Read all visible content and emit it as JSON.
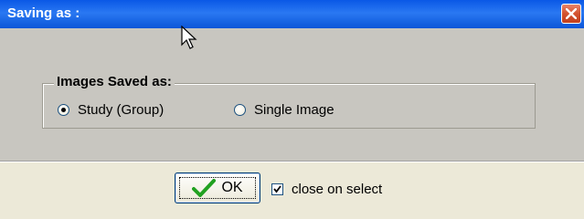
{
  "window": {
    "title": "Saving as :"
  },
  "group": {
    "title": "Images Saved as:",
    "options": [
      {
        "label": "Study (Group)",
        "checked": true
      },
      {
        "label": "Single Image",
        "checked": false
      }
    ]
  },
  "footer": {
    "ok_label": "OK",
    "close_on_select_label": "close on select",
    "close_on_select_checked": true
  },
  "colors": {
    "titlebar": "#0a58e6",
    "dialog_bg": "#ece9d8",
    "panel_bg": "#c8c6c0",
    "close_red": "#c2401d",
    "check_green": "#21a121"
  }
}
